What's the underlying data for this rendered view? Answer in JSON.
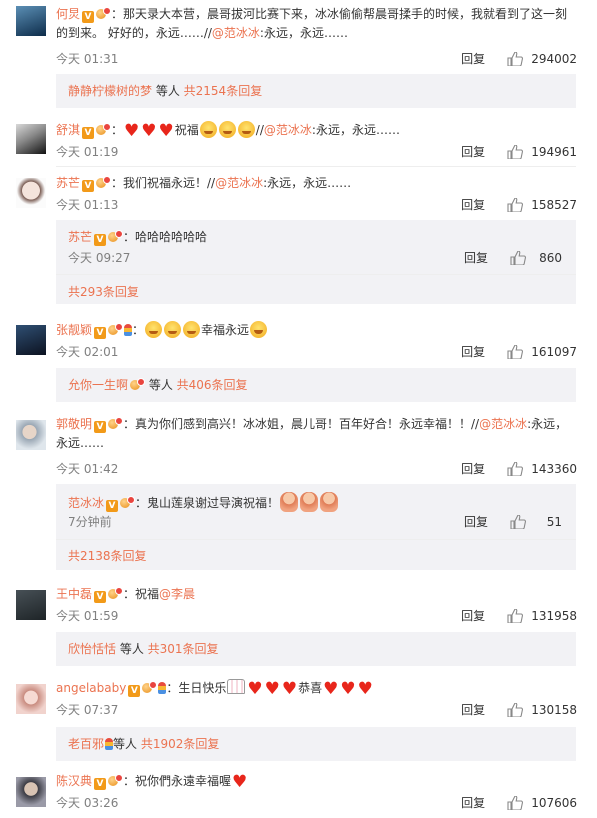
{
  "actions": {
    "reply_label": "回复"
  },
  "comments": [
    {
      "user": "何炅",
      "badges": [
        "v",
        "m"
      ],
      "text_a": "：那天录大本营，晨哥拔河比赛下来，冰冰偷偷帮晨哥揉手的时候，我就看到了这一刻",
      "text_b": "的到来。 好好的，永远……//",
      "mention": "@范冰冰",
      "text_c": ":永远，永远……",
      "time": "今天 01:31",
      "likes": "294002",
      "summary": {
        "users": "静静柠檬树的梦",
        "and": " 等人 ",
        "count": "共2154条回复"
      }
    },
    {
      "user": "舒淇",
      "badges": [
        "v",
        "m"
      ],
      "text_a": "：",
      "text_b": "祝福",
      "text_c": "//",
      "mention": "@范冰冰",
      "text_d": ":永远，永远……",
      "time": "今天 01:19",
      "likes": "194961"
    },
    {
      "user": "苏芒",
      "badges": [
        "v",
        "m"
      ],
      "text_a": "：我们祝福永远！//",
      "mention": "@范冰冰",
      "text_b": ":永远，永远……",
      "time": "今天 01:13",
      "likes": "158527",
      "sub": {
        "user": "苏芒",
        "text": "：哈哈哈哈哈哈",
        "time": "今天 09:27",
        "likes": "860"
      },
      "more": "共293条回复"
    },
    {
      "user": "张靓颖",
      "badges": [
        "v",
        "m",
        "b"
      ],
      "text_a": "：",
      "text_b": "幸福永远",
      "time": "今天 02:01",
      "likes": "161097",
      "summary": {
        "users": "允你一生啊",
        "and": " 等人 ",
        "count": "共406条回复"
      }
    },
    {
      "user": "郭敬明",
      "badges": [
        "v",
        "m"
      ],
      "text_a": "：真为你们感到高兴！冰冰姐，晨儿哥！百年好合！永远幸福！！//",
      "mention": "@范冰冰",
      "text_b": ":永远，",
      "text_c": "永远……",
      "time": "今天 01:42",
      "likes": "143360",
      "sub": {
        "user": "范冰冰",
        "text": "：鬼山莲泉谢过导演祝福！",
        "time": "7分钟前",
        "likes": "51"
      },
      "more": "共2138条回复"
    },
    {
      "user": "王中磊",
      "badges": [
        "v",
        "m"
      ],
      "text_a": "：祝福",
      "mention": "@李晨",
      "time": "今天 01:59",
      "likes": "131958",
      "summary": {
        "users": "欣怡恬恬",
        "and": " 等人 ",
        "count": "共301条回复"
      }
    },
    {
      "user": "angelababy",
      "badges": [
        "v",
        "m",
        "b"
      ],
      "text_a": "：生日快乐",
      "text_b": "恭喜",
      "time": "今天 07:37",
      "likes": "130158",
      "summary": {
        "users": "老百邪",
        "and": "等人 ",
        "count": "共1902条回复"
      }
    },
    {
      "user": "陈汉典",
      "badges": [
        "v",
        "m"
      ],
      "text_a": "：祝你們永遠幸福喔",
      "time": "今天 03:26",
      "likes": "107606"
    }
  ]
}
